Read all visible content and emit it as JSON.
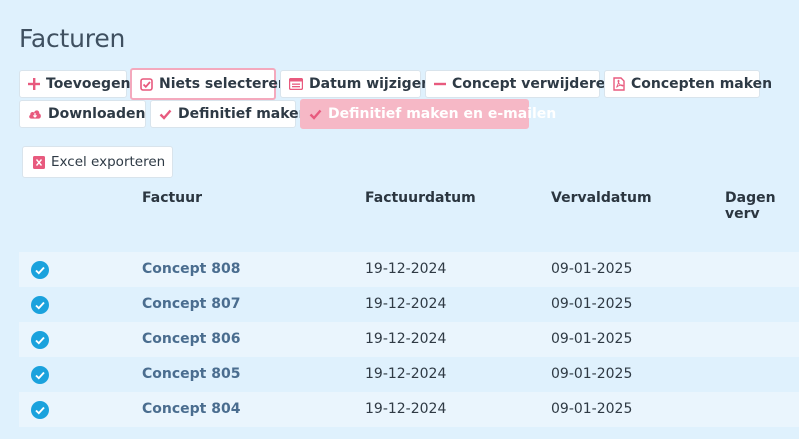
{
  "page": {
    "title": "Facturen"
  },
  "toolbar": {
    "add_label": "Toevoegen",
    "deselect_label": "Niets selecteren",
    "change_date_label": "Datum wijzigen",
    "delete_concept_label": "Concept verwijderen",
    "make_concepts_label": "Concepten maken",
    "download_label": "Downloaden",
    "finalize_label": "Definitief maken",
    "finalize_email_label": "Definitief maken en e-mailen",
    "excel_label": "Excel exporteren"
  },
  "colors": {
    "accent": "#e85a7e",
    "check": "#1aa2dd",
    "link": "#4a6d8f",
    "background": "#dff1fd"
  },
  "table": {
    "headers": {
      "invoice": "Factuur",
      "invoice_date": "Factuurdatum",
      "due_date": "Vervaldatum",
      "days_overdue": "Dagen verv"
    },
    "rows": [
      {
        "invoice": "Concept 808",
        "invoice_date": "19-12-2024",
        "due_date": "09-01-2025",
        "selected": true
      },
      {
        "invoice": "Concept 807",
        "invoice_date": "19-12-2024",
        "due_date": "09-01-2025",
        "selected": true
      },
      {
        "invoice": "Concept 806",
        "invoice_date": "19-12-2024",
        "due_date": "09-01-2025",
        "selected": true
      },
      {
        "invoice": "Concept 805",
        "invoice_date": "19-12-2024",
        "due_date": "09-01-2025",
        "selected": true
      },
      {
        "invoice": "Concept 804",
        "invoice_date": "19-12-2024",
        "due_date": "09-01-2025",
        "selected": true
      }
    ]
  }
}
